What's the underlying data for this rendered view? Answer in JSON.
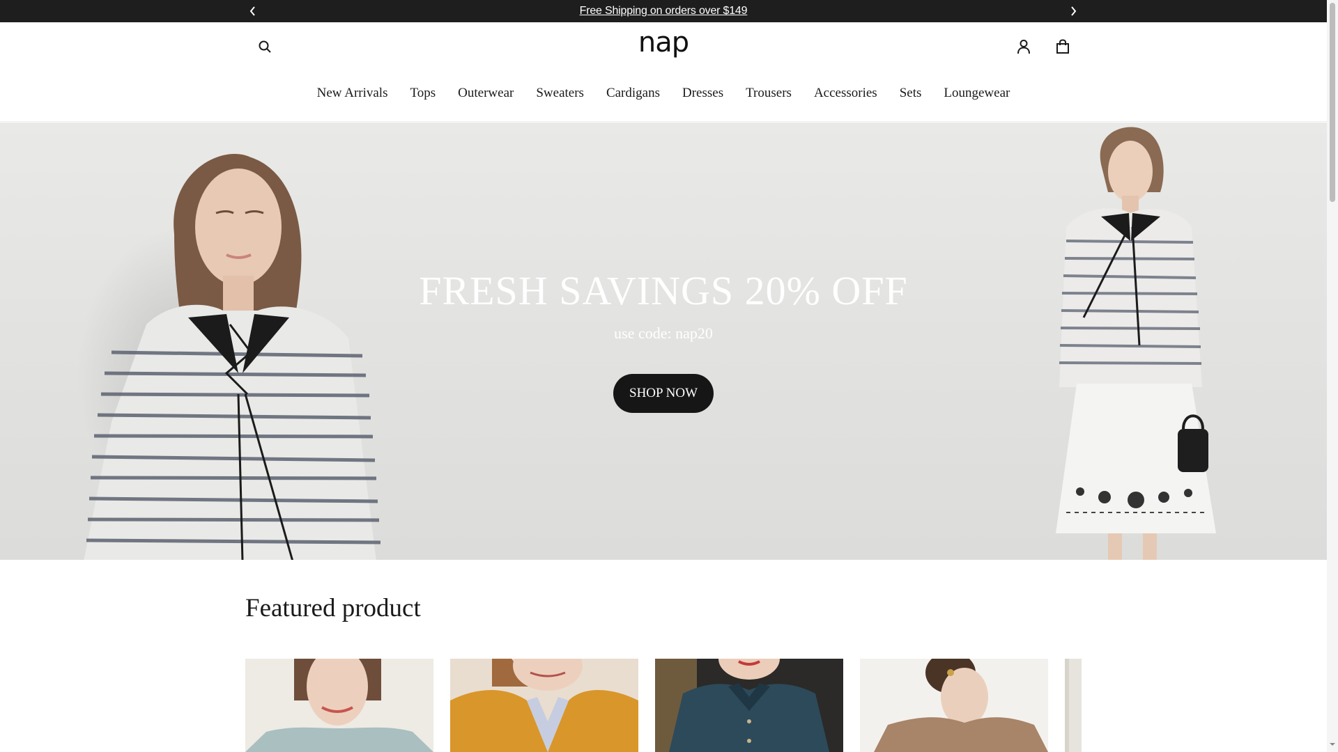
{
  "announcement": {
    "message": "Free Shipping on orders over $149",
    "prev_icon": "chevron-left-icon",
    "next_icon": "chevron-right-icon"
  },
  "header": {
    "logo": "nap",
    "search_icon": "search-icon",
    "account_icon": "user-icon",
    "cart_icon": "shopping-bag-icon"
  },
  "nav": {
    "items": [
      {
        "label": "New Arrivals"
      },
      {
        "label": "Tops"
      },
      {
        "label": "Outerwear"
      },
      {
        "label": "Sweaters"
      },
      {
        "label": "Cardigans"
      },
      {
        "label": "Dresses"
      },
      {
        "label": "Trousers"
      },
      {
        "label": "Accessories"
      },
      {
        "label": "Sets"
      },
      {
        "label": "Loungewear"
      }
    ]
  },
  "hero": {
    "title": "FRESH SAVINGS 20% OFF",
    "subtitle": "use code: nap20",
    "cta_label": "SHOP NOW"
  },
  "featured": {
    "title": "Featured product",
    "cards": [
      {
        "color": "#a9bfc0"
      },
      {
        "color": "#d9962a"
      },
      {
        "color": "#2d4a5a"
      },
      {
        "color": "#a88468"
      },
      {
        "color": "#e7e4de"
      }
    ]
  },
  "colors": {
    "announcement_bg": "#1e1e1e",
    "cta_bg": "#161616",
    "text": "#1a1a1a"
  }
}
